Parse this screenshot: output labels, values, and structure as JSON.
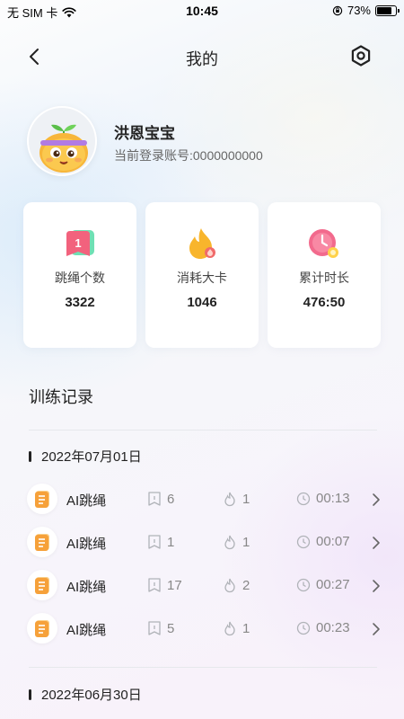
{
  "status_bar": {
    "carrier": "无 SIM 卡",
    "time": "10:45",
    "battery": "73%",
    "battery_level": 0.73
  },
  "nav": {
    "title": "我的",
    "back_icon": "chevron-left-icon",
    "settings_icon": "hexagon-settings-icon"
  },
  "profile": {
    "name": "洪恩宝宝",
    "account": "当前登录账号:0000000000"
  },
  "stats": [
    {
      "label": "跳绳个数",
      "value": "3322",
      "icon": "jump-count-icon"
    },
    {
      "label": "消耗大卡",
      "value": "1046",
      "icon": "flame-icon"
    },
    {
      "label": "累计时长",
      "value": "476:50",
      "icon": "clock-icon"
    }
  ],
  "records": {
    "title": "训练记录",
    "groups": [
      {
        "date": "2022年07月01日",
        "items": [
          {
            "name": "AI跳绳",
            "count": "6",
            "calories": "1",
            "duration": "00:13"
          },
          {
            "name": "AI跳绳",
            "count": "1",
            "calories": "1",
            "duration": "00:07"
          },
          {
            "name": "AI跳绳",
            "count": "17",
            "calories": "2",
            "duration": "00:27"
          },
          {
            "name": "AI跳绳",
            "count": "5",
            "calories": "1",
            "duration": "00:23"
          }
        ]
      },
      {
        "date": "2022年06月30日",
        "items": []
      }
    ]
  },
  "colors": {
    "accent_orange": "#f6a13a",
    "pink": "#f06a8a",
    "green": "#4fd1a0",
    "muted_gray": "#888888"
  }
}
